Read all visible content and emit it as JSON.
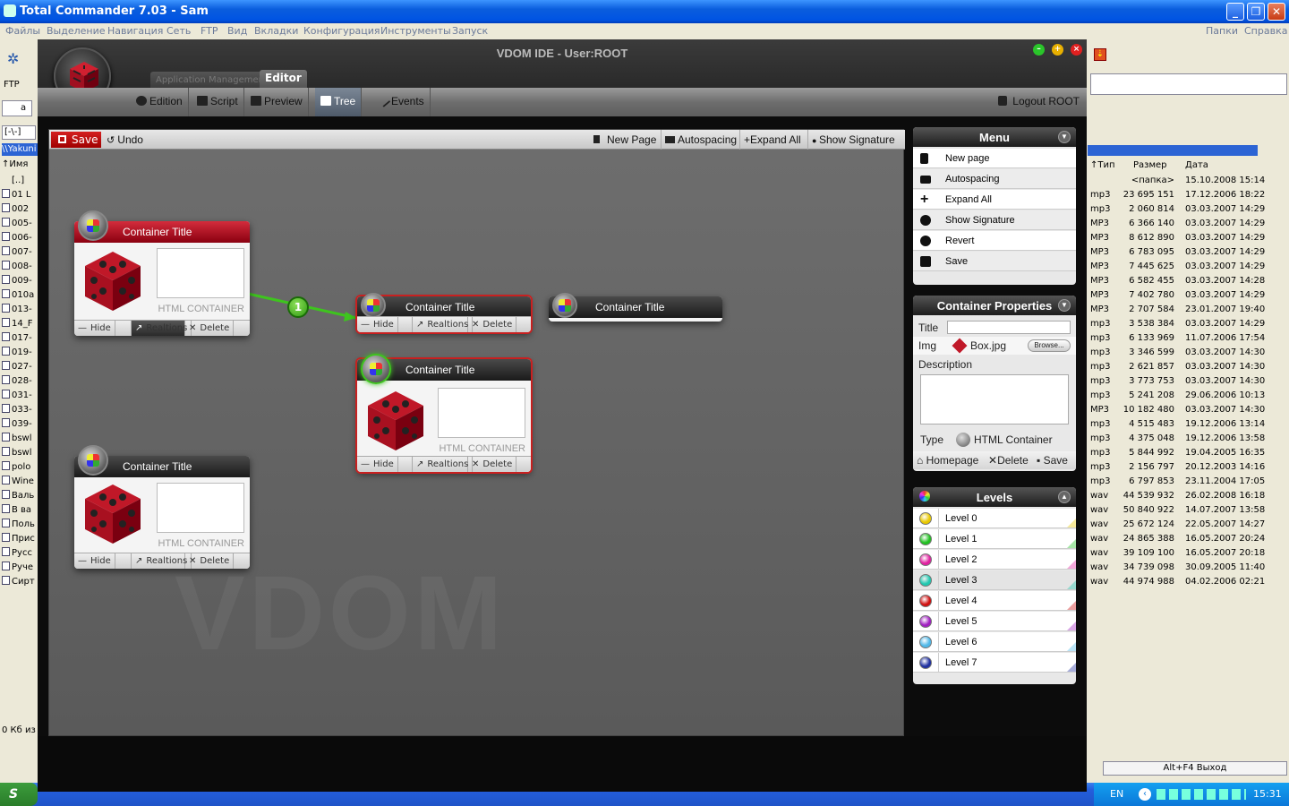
{
  "tc": {
    "title": "Total Commander 7.03 - Sam",
    "menu": [
      "Файлы",
      "Выделение",
      "Навигация",
      "Сеть",
      "FTP",
      "Вид",
      "Вкладки",
      "Конфигурация",
      "Инструменты",
      "Запуск"
    ],
    "menu_right": [
      "Папки",
      "Справка"
    ],
    "ftp_label": "FTP",
    "drive_label": "a",
    "path_selector": "[-\\-]",
    "path_text": "\\\\Yakuni",
    "left_header": "↑Имя",
    "left_files": [
      "[..]",
      "01 L",
      "002",
      "005-",
      "006-",
      "007-",
      "008-",
      "009-",
      "010a",
      "013-",
      "14_F",
      "017-",
      "019-",
      "027-",
      "028-",
      "031-",
      "033-",
      "039-",
      "bswl",
      "bswl",
      "polo",
      "Wine",
      "Валь",
      "В ва",
      "Поль",
      "Прис",
      "Русс",
      "Руче",
      "Сирт"
    ],
    "left_status": "0 Кб из",
    "right_headers": {
      "type": "↑Тип",
      "size": "Размер",
      "date": "Дата"
    },
    "right_rows": [
      {
        "type": "",
        "size": "<папка>",
        "date": "15.10.2008 15:14"
      },
      {
        "type": "mp3",
        "size": "23 695 151",
        "date": "17.12.2006 18:22"
      },
      {
        "type": "mp3",
        "size": "2 060 814",
        "date": "03.03.2007 14:29"
      },
      {
        "type": "MP3",
        "size": "6 366 140",
        "date": "03.03.2007 14:29"
      },
      {
        "type": "MP3",
        "size": "8 612 890",
        "date": "03.03.2007 14:29"
      },
      {
        "type": "MP3",
        "size": "6 783 095",
        "date": "03.03.2007 14:29"
      },
      {
        "type": "MP3",
        "size": "7 445 625",
        "date": "03.03.2007 14:29"
      },
      {
        "type": "MP3",
        "size": "6 582 455",
        "date": "03.03.2007 14:28"
      },
      {
        "type": "MP3",
        "size": "7 402 780",
        "date": "03.03.2007 14:29"
      },
      {
        "type": "MP3",
        "size": "2 707 584",
        "date": "23.01.2007 19:40"
      },
      {
        "type": "mp3",
        "size": "3 538 384",
        "date": "03.03.2007 14:29"
      },
      {
        "type": "mp3",
        "size": "6 133 969",
        "date": "11.07.2006 17:54"
      },
      {
        "type": "mp3",
        "size": "3 346 599",
        "date": "03.03.2007 14:30"
      },
      {
        "type": "mp3",
        "size": "2 621 857",
        "date": "03.03.2007 14:30"
      },
      {
        "type": "mp3",
        "size": "3 773 753",
        "date": "03.03.2007 14:30"
      },
      {
        "type": "mp3",
        "size": "5 241 208",
        "date": "29.06.2006 10:13"
      },
      {
        "type": "MP3",
        "size": "10 182 480",
        "date": "03.03.2007 14:30"
      },
      {
        "type": "mp3",
        "size": "4 515 483",
        "date": "19.12.2006 13:14"
      },
      {
        "type": "mp3",
        "size": "4 375 048",
        "date": "19.12.2006 13:58"
      },
      {
        "type": "mp3",
        "size": "5 844 992",
        "date": "19.04.2005 16:35"
      },
      {
        "type": "mp3",
        "size": "2 156 797",
        "date": "20.12.2003 14:16"
      },
      {
        "type": "mp3",
        "size": "6 797 853",
        "date": "23.11.2004 17:05"
      },
      {
        "type": "wav",
        "size": "44 539 932",
        "date": "26.02.2008 16:18"
      },
      {
        "type": "wav",
        "size": "50 840 922",
        "date": "14.07.2007 13:58"
      },
      {
        "type": "wav",
        "size": "25 672 124",
        "date": "22.05.2007 14:27"
      },
      {
        "type": "wav",
        "size": "24 865 388",
        "date": "16.05.2007 20:24"
      },
      {
        "type": "wav",
        "size": "39 109 100",
        "date": "16.05.2007 20:18"
      },
      {
        "type": "wav",
        "size": "34 739 098",
        "date": "30.09.2005 11:40"
      },
      {
        "type": "wav",
        "size": "44 974 988",
        "date": "04.02.2006 02:21"
      }
    ],
    "exit_button": "Alt+F4 Выход",
    "taskbar": {
      "start": "S",
      "lang": "EN",
      "clock": "15:31"
    }
  },
  "ide": {
    "title": "VDOM IDE - User:ROOT",
    "app_tabs": [
      "Application Management",
      "Editor"
    ],
    "toolbar": [
      "Edition",
      "Script",
      "Preview",
      "Tree",
      "Events"
    ],
    "logout": "Logout ROOT",
    "canvas_toolbar": {
      "save": "Save",
      "undo": "Undo",
      "new_page": "New Page",
      "autospacing": "Autospacing",
      "expand_all": "Expand All",
      "show_signature": "Show Signature"
    },
    "watermark": "VDOM",
    "link_badge": "1",
    "containers": [
      {
        "title": "Container Title",
        "label": "HTML CONTAINER",
        "hide": "Hide",
        "relations": "Realtions",
        "delete": "Delete"
      },
      {
        "title": "Container Title",
        "hide": "Hide",
        "relations": "Realtions",
        "delete": "Delete"
      },
      {
        "title": "Container Title"
      },
      {
        "title": "Container Title",
        "label": "HTML CONTAINER",
        "hide": "Hide",
        "relations": "Realtions",
        "delete": "Delete"
      },
      {
        "title": "Container Title",
        "label": "HTML CONTAINER",
        "hide": "Hide",
        "relations": "Realtions",
        "delete": "Delete"
      }
    ],
    "menu_panel": {
      "title": "Menu",
      "items": [
        "New page",
        "Autospacing",
        "Expand All",
        "Show Signature",
        "Revert",
        "Save"
      ]
    },
    "props_panel": {
      "title": "Container Properties",
      "title_label": "Title",
      "title_value": "",
      "img_label": "Img",
      "img_value": "Box.jpg",
      "browse": "Browse...",
      "description_label": "Description",
      "type_label": "Type",
      "type_value": "HTML Container",
      "homepage": "Homepage",
      "delete": "Delete",
      "save": "Save"
    },
    "levels_panel": {
      "title": "Levels",
      "levels": [
        {
          "name": "Level 0",
          "color": "#e8c800"
        },
        {
          "name": "Level 1",
          "color": "#20c020"
        },
        {
          "name": "Level 2",
          "color": "#e020a0"
        },
        {
          "name": "Level 3",
          "color": "#20c8b0"
        },
        {
          "name": "Level 4",
          "color": "#d01010"
        },
        {
          "name": "Level 5",
          "color": "#a020c0"
        },
        {
          "name": "Level 6",
          "color": "#50b8e8"
        },
        {
          "name": "Level 7",
          "color": "#2030a0"
        }
      ]
    }
  }
}
